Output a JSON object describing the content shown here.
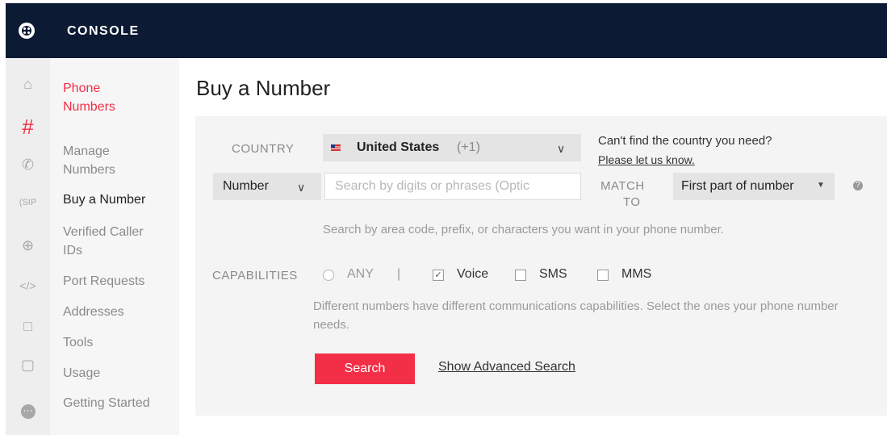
{
  "header": {
    "brand": "CONSOLE"
  },
  "icon_rail": [
    "home-icon",
    "hash-icon",
    "phone-icon",
    "sip-icon",
    "search-icon",
    "code-icon",
    "video-icon",
    "chat-icon",
    "more-icon"
  ],
  "sidebar": {
    "section": "Phone\nNumbers",
    "items": [
      {
        "label": "Manage\nNumbers"
      },
      {
        "label": "Buy a Number"
      },
      {
        "label": "Verified Caller\nIDs"
      },
      {
        "label": "Port Requests"
      },
      {
        "label": "Addresses"
      },
      {
        "label": "Tools"
      },
      {
        "label": "Usage"
      },
      {
        "label": "Getting Started"
      }
    ]
  },
  "page": {
    "title": "Buy a Number"
  },
  "form": {
    "country_label": "COUNTRY",
    "country_value": "United States",
    "country_code": "(+1)",
    "country_help": "Can't find the country you need?",
    "country_help_link": "Please let us know.",
    "search_type": "Number",
    "search_placeholder": "Search by digits or phrases (Optic",
    "match_label_1": "MATCH",
    "match_label_2": "TO",
    "match_value": "First part of number",
    "search_help": "Search by area code, prefix, or characters you want in your phone number.",
    "capabilities_label": "CAPABILITIES",
    "cap_any": "ANY",
    "cap_sep": "|",
    "cap_voice": "Voice",
    "cap_sms": "SMS",
    "cap_mms": "MMS",
    "cap_help": "Different numbers have different communications capabilities. Select the ones your phone number needs.",
    "search_button": "Search",
    "advanced_link": "Show Advanced Search"
  },
  "colors": {
    "accent": "#f22f46",
    "topbar": "#0d1a33"
  }
}
